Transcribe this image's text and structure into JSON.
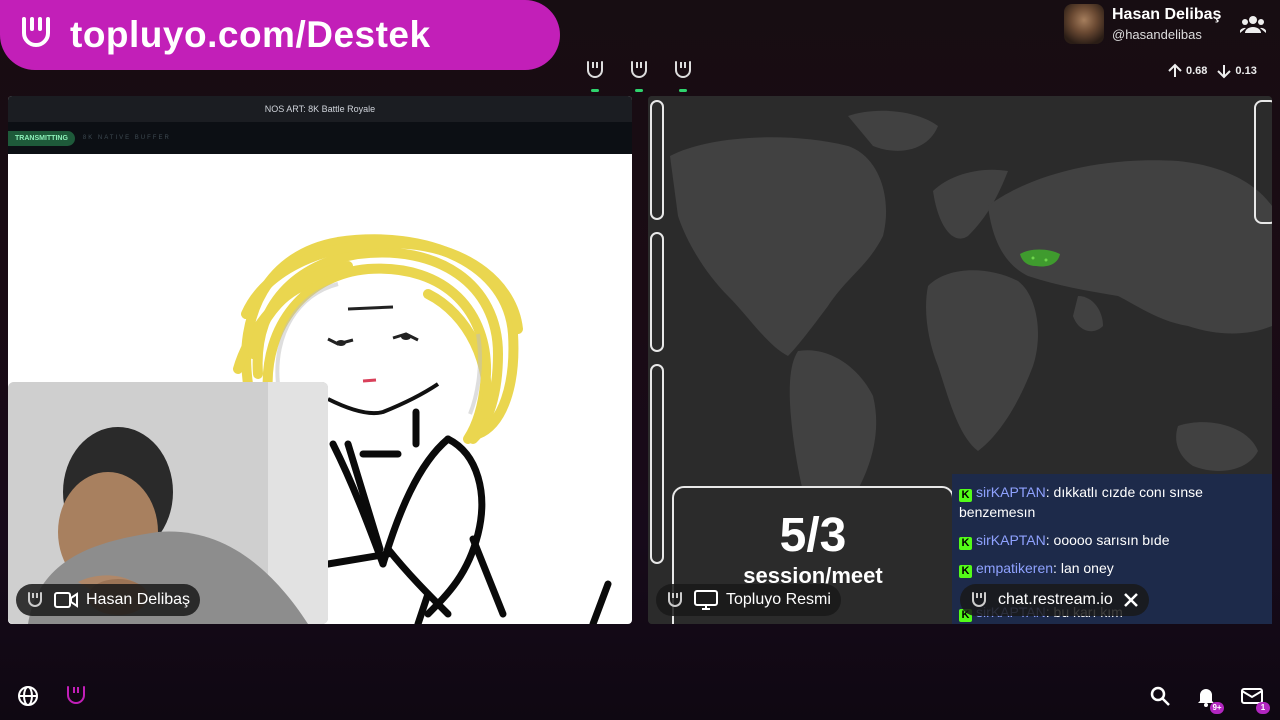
{
  "banner": {
    "url": "topluyo.com/Destek"
  },
  "mics": [
    {
      "name": "mic-1"
    },
    {
      "name": "mic-2"
    },
    {
      "name": "mic-3"
    }
  ],
  "user": {
    "name": "Hasan Delibaş",
    "handle": "@hasandelibas"
  },
  "stats": {
    "upload": "0.68",
    "download": "0.13"
  },
  "left_panel": {
    "title": "NOS ART: 8K Battle Royale",
    "status": "TRANSMITTING",
    "status_sub": "8K NATIVE BUFFER",
    "camera_label": "Hasan Delibaş"
  },
  "right_panel": {
    "session_count": "5/3",
    "session_label": "session/meet",
    "screen_label": "Topluyo Resmi"
  },
  "chat": {
    "messages": [
      {
        "user": "sirKAPTAN",
        "text": "dıkkatlı cızde conı sınse benzemesın"
      },
      {
        "user": "sirKAPTAN",
        "text": "ooooo sarısın bıde"
      },
      {
        "user": "empatikeren",
        "text": "lan oney"
      },
      {
        "user": "sirKAPTAN",
        "text": "bu karı kım"
      }
    ],
    "source_label": "chat.restream.io"
  },
  "notifications": {
    "count": "9+"
  },
  "messages": {
    "count": "1"
  },
  "colors": {
    "accent": "#c21fb8",
    "kick": "#53fc18",
    "chat_user": "#8fa2ff"
  }
}
